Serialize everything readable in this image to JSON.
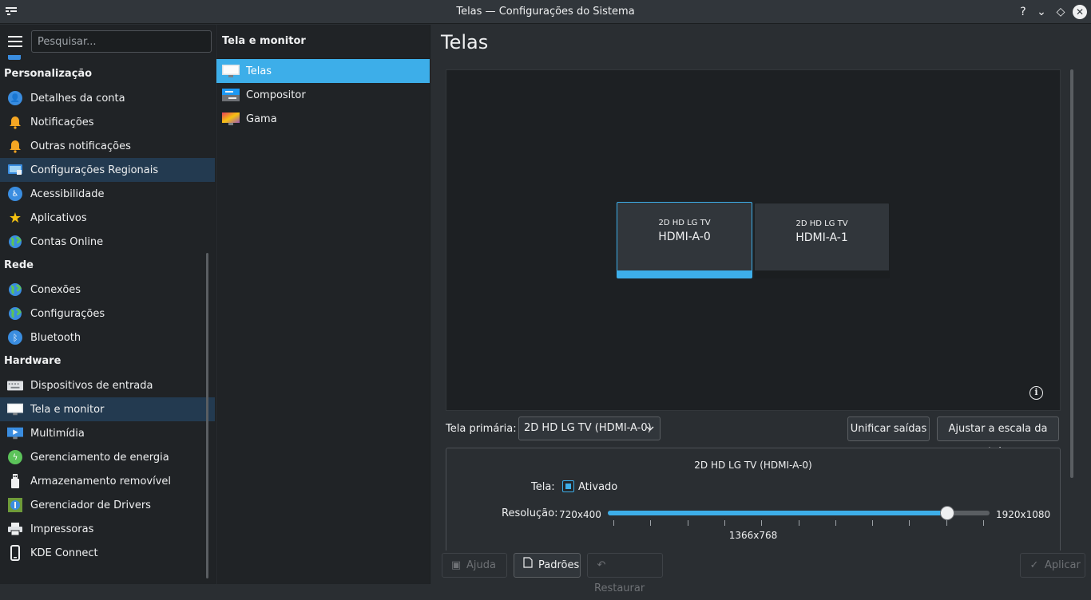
{
  "window": {
    "title": "Telas — Configurações do Sistema",
    "help_glyph": "?",
    "min_glyph": "⌄",
    "max_glyph": "◇",
    "close_glyph": "✕"
  },
  "sidebar": {
    "search_placeholder": "Pesquisar...",
    "sections": [
      {
        "header": "Personalização",
        "items": [
          {
            "label": "Detalhes da conta",
            "icon": "user-icon"
          },
          {
            "label": "Notificações",
            "icon": "bell-icon"
          },
          {
            "label": "Outras notificações",
            "icon": "bell-icon"
          },
          {
            "label": "Configurações Regionais",
            "icon": "regional-icon"
          },
          {
            "label": "Acessibilidade",
            "icon": "accessibility-icon"
          },
          {
            "label": "Aplicativos",
            "icon": "star-icon"
          },
          {
            "label": "Contas Online",
            "icon": "globe-icon"
          }
        ]
      },
      {
        "header": "Rede",
        "items": [
          {
            "label": "Conexões",
            "icon": "globe-icon"
          },
          {
            "label": "Configurações",
            "icon": "globe-icon"
          },
          {
            "label": "Bluetooth",
            "icon": "bluetooth-icon"
          }
        ]
      },
      {
        "header": "Hardware",
        "items": [
          {
            "label": "Dispositivos de entrada",
            "icon": "keyboard-icon"
          },
          {
            "label": "Tela e monitor",
            "icon": "monitor-icon"
          },
          {
            "label": "Multimídia",
            "icon": "multimedia-icon"
          },
          {
            "label": "Gerenciamento de energia",
            "icon": "power-icon"
          },
          {
            "label": "Armazenamento removível",
            "icon": "usb-icon"
          },
          {
            "label": "Gerenciador de Drivers",
            "icon": "driver-icon"
          },
          {
            "label": "Impressoras",
            "icon": "printer-icon"
          },
          {
            "label": "KDE Connect",
            "icon": "phone-icon"
          }
        ]
      }
    ]
  },
  "middle": {
    "header": "Tela e monitor",
    "items": [
      {
        "label": "Telas",
        "icon": "monitor-icon",
        "selected": true
      },
      {
        "label": "Compositor",
        "icon": "compositor-icon"
      },
      {
        "label": "Gama",
        "icon": "gamma-icon"
      }
    ]
  },
  "main": {
    "title": "Telas",
    "monitors": [
      {
        "name": "2D HD LG TV",
        "port": "HDMI-A-0",
        "active": true
      },
      {
        "name": "2D HD LG TV",
        "port": "HDMI-A-1",
        "active": false
      }
    ],
    "info_glyph": "i",
    "primary_label": "Tela primária:",
    "primary_value": "2D HD LG TV (HDMI-A-0)",
    "unify_button": "Unificar saídas",
    "scale_button": "Ajustar a escala da tela",
    "output": {
      "title": "2D HD LG TV (HDMI-A-0)",
      "enabled_label": "Tela:",
      "enabled_value": "Ativado",
      "enabled": true,
      "resolution_label": "Resolução:",
      "resolution_min": "720x400",
      "resolution_max": "1920x1080",
      "resolution_current": "1366x768",
      "resolution_fraction": 0.89,
      "tick_count": 11
    }
  },
  "footer": {
    "help": "Ajuda",
    "defaults": "Padrões",
    "reset": "Restaurar",
    "apply": "Aplicar"
  },
  "colors": {
    "accent": "#3daee9",
    "sidebar_highlight": "#233a50",
    "background": "#2a2e32"
  }
}
